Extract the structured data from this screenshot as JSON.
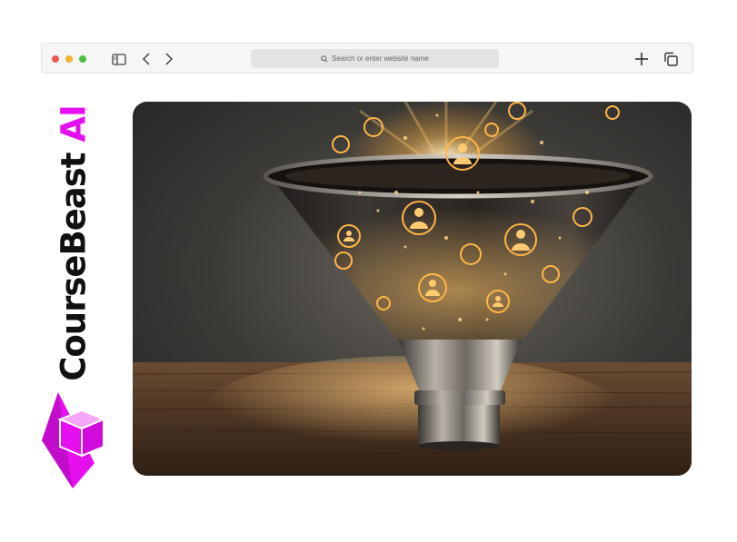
{
  "browser": {
    "search_placeholder": "Search or enter website name",
    "icons": [
      "sidebar-icon",
      "back-chevron-icon",
      "forward-chevron-icon",
      "search-icon",
      "new-tab-plus-icon",
      "tabs-overview-icon"
    ]
  },
  "brand": {
    "name": "CourseBeast",
    "suffix": "AI",
    "accent_color": "#e60ff0"
  },
  "hero_image": {
    "alt": "Glowing funnel with people icons on wooden table"
  }
}
